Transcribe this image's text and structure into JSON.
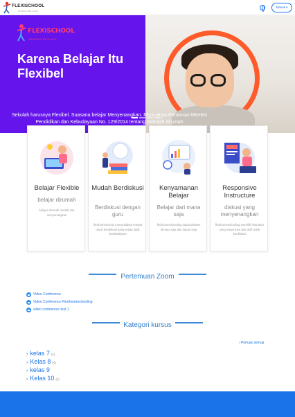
{
  "header": {
    "logo_text": "FLEXISCHOOL",
    "logo_sub": "RUMAH BELAJAR",
    "login_label": "Masuk ▾"
  },
  "hero": {
    "brand_text": "FLEXISCHOOL",
    "brand_sub": "HOMESCHOOLING",
    "title": "Karena Belajar Itu Flexibel",
    "text": "Sekolah harusnya Flexibel. Suasana belajar Menyenangkan. Munculnya Peraturan Menteri Pendidikan dan Kebudayaan No. 129/2014 tentang Sekolah dirumah",
    "slides": 4,
    "active_slide": 1
  },
  "features": [
    {
      "title": "Belajar Flexible",
      "subtitle": "belajar dirumah",
      "desc": "belajar dirumah mudah dan menyenangkan"
    },
    {
      "title": "Mudah Berdiskusi",
      "subtitle": "Berdiskusi dengan guru",
      "desc": "flexihomeschool menyediakan tempat untuk berdiskusi pada setiap topik pembelajaran"
    },
    {
      "title": "Kenyamanan Belajar",
      "subtitle": "Belajar dari mana saja",
      "desc": "flexihomeschooling dapat diakses dimana saja dan kapan saja"
    },
    {
      "title": "Responsive Instructure",
      "subtitle": "diskusi yang menyenangkan",
      "desc": "flexihomeschooling memiliki instruktur yang responsive dan aktif untuk berdiskusi"
    }
  ],
  "zoom": {
    "heading": "Pertemuan Zoom",
    "items": [
      "Video Conference",
      "Video Conference Flexihomeschooling",
      "video conference test 1"
    ]
  },
  "courses": {
    "heading": "Kategori kursus",
    "browse_all": "› Perluas semua",
    "items": [
      {
        "name": "kelas 7",
        "count": "(1)"
      },
      {
        "name": "Kelas 8",
        "count": "(4)"
      },
      {
        "name": "kelas 9",
        "count": ""
      },
      {
        "name": "Kelas 10",
        "count": "(2)"
      }
    ]
  },
  "colors": {
    "primary": "#1a73e8",
    "hero_purple": "#6514ec",
    "ring_orange": "#ff5a2a",
    "brand_pink": "#ff3d6e",
    "footer": "#1a73e8"
  }
}
